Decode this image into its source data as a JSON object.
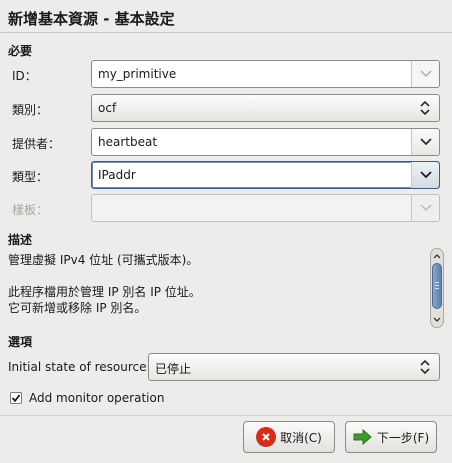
{
  "window": {
    "title": "新增基本資源 - 基本設定"
  },
  "required": {
    "heading": "必要",
    "id": {
      "label": "ID：",
      "value": "my_primitive"
    },
    "class": {
      "label": "類別：",
      "value": "ocf"
    },
    "provider": {
      "label": "提供者：",
      "value": "heartbeat"
    },
    "type": {
      "label": "類型：",
      "value": "IPaddr"
    },
    "template": {
      "label": "樣板：",
      "value": ""
    }
  },
  "description": {
    "heading": "描述",
    "lines": [
      "管理虛擬 IPv4 位址 (可攜式版本)。",
      "此程序檔用於管理 IP 別名 IP 位址。",
      "它可新增或移除 IP 別名。"
    ]
  },
  "options": {
    "heading": "選項",
    "initial_state": {
      "label": "Initial state of resource:",
      "value": "已停止"
    },
    "monitor": {
      "label": "Add monitor operation",
      "checked": true
    }
  },
  "buttons": {
    "cancel": "取消(C)",
    "next": "下一步(F)"
  },
  "colors": {
    "accent": "#5b7fb0",
    "cancel_icon": "#d62c1a",
    "next_icon": "#3f9a2e"
  }
}
